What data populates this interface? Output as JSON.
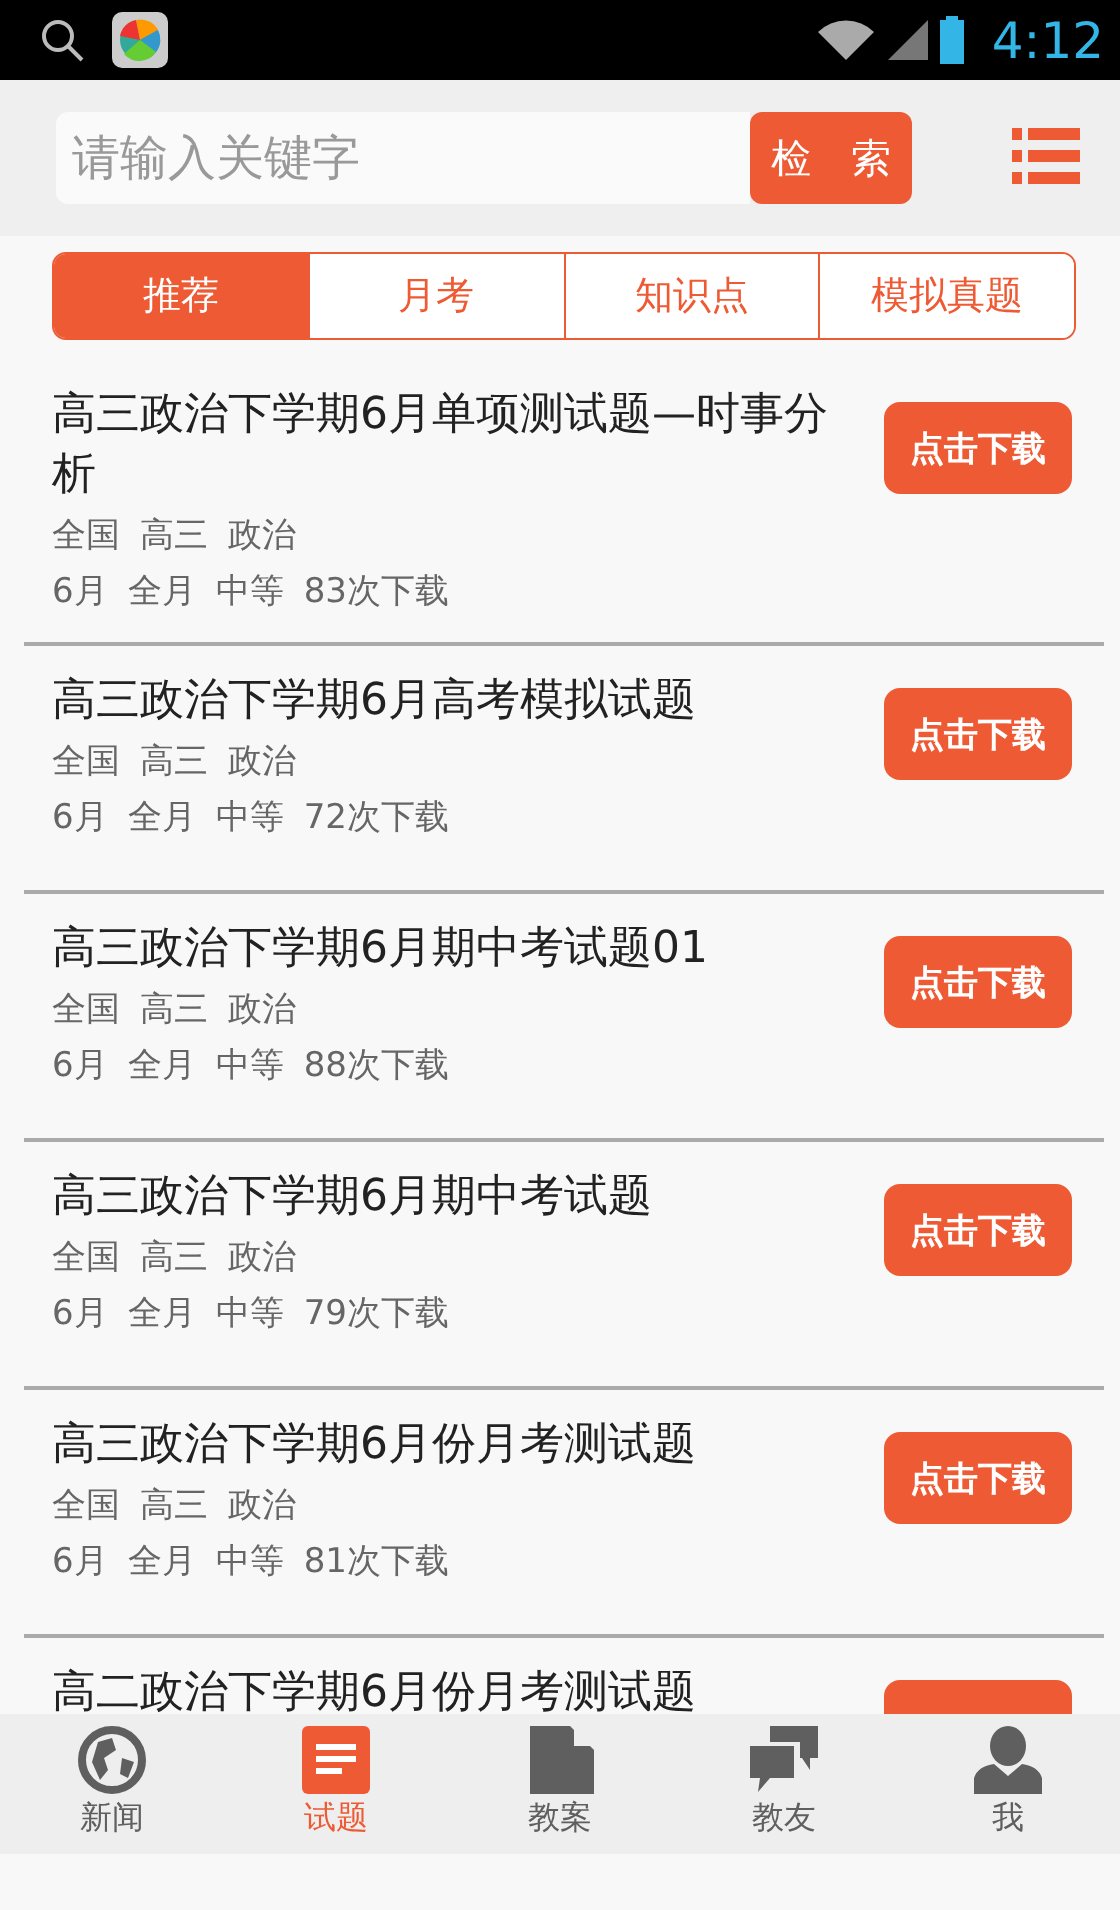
{
  "status_bar": {
    "time": "4:12"
  },
  "search": {
    "placeholder": "请输入关键字",
    "button": "检　索"
  },
  "tabs": [
    {
      "label": "推荐",
      "selected": true
    },
    {
      "label": "月考",
      "selected": false
    },
    {
      "label": "知识点",
      "selected": false
    },
    {
      "label": "模拟真题",
      "selected": false
    }
  ],
  "items": [
    {
      "title": "高三政治下学期6月单项测试题—时事分析",
      "tags": [
        "全国",
        "高三",
        "政治"
      ],
      "info": [
        "6月",
        "全月",
        "中等",
        "83次下载"
      ],
      "button": "点击下载"
    },
    {
      "title": "高三政治下学期6月高考模拟试题",
      "tags": [
        "全国",
        "高三",
        "政治"
      ],
      "info": [
        "6月",
        "全月",
        "中等",
        "72次下载"
      ],
      "button": "点击下载"
    },
    {
      "title": "高三政治下学期6月期中考试题01",
      "tags": [
        "全国",
        "高三",
        "政治"
      ],
      "info": [
        "6月",
        "全月",
        "中等",
        "88次下载"
      ],
      "button": "点击下载"
    },
    {
      "title": "高三政治下学期6月期中考试题",
      "tags": [
        "全国",
        "高三",
        "政治"
      ],
      "info": [
        "6月",
        "全月",
        "中等",
        "79次下载"
      ],
      "button": "点击下载"
    },
    {
      "title": "高三政治下学期6月份月考测试题",
      "tags": [
        "全国",
        "高三",
        "政治"
      ],
      "info": [
        "6月",
        "全月",
        "中等",
        "81次下载"
      ],
      "button": "点击下载"
    },
    {
      "title": "高二政治下学期6月份月考测试题"
    }
  ],
  "nav": [
    {
      "label": "新闻",
      "kind": "globe",
      "selected": false
    },
    {
      "label": "试题",
      "kind": "paper",
      "selected": true
    },
    {
      "label": "教案",
      "kind": "document",
      "selected": false
    },
    {
      "label": "教友",
      "kind": "chat",
      "selected": false
    },
    {
      "label": "我",
      "kind": "user",
      "selected": false
    }
  ]
}
